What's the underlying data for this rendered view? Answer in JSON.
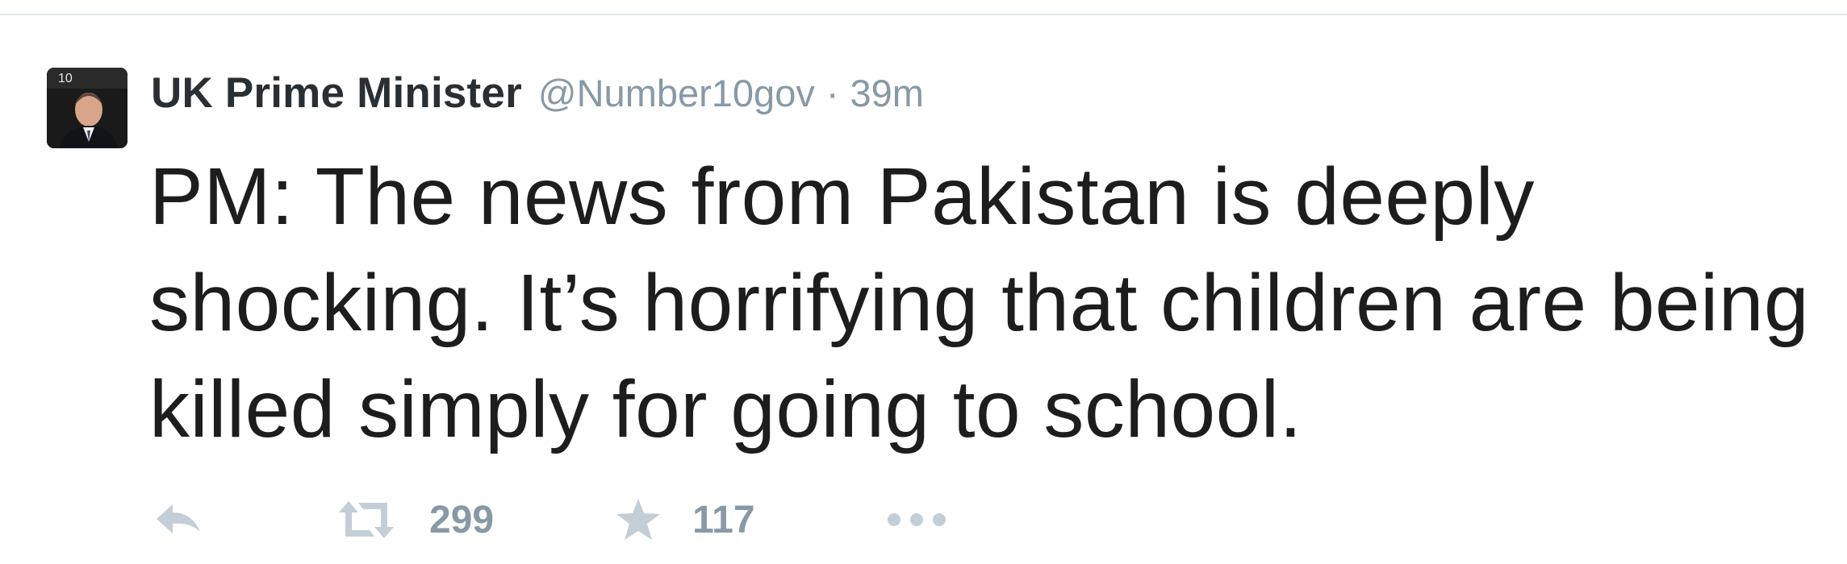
{
  "tweet": {
    "author_name": "UK Prime Minister",
    "handle": "@Number10gov",
    "separator": "·",
    "timestamp": "39m",
    "text": "PM: The news from Pakistan is deeply shocking. It’s horrifying that children are being killed simply for going to school.",
    "avatar_badge": "10",
    "actions": {
      "reply_icon": "reply-icon",
      "retweet_icon": "retweet-icon",
      "retweet_count": "299",
      "favorite_icon": "star-icon",
      "favorite_count": "117",
      "more_icon": "more-dots-icon"
    }
  },
  "colors": {
    "text": "#1d1d1d",
    "muted": "#8899a6",
    "icon": "#bcc8d2",
    "divider": "#e1e8ed"
  }
}
